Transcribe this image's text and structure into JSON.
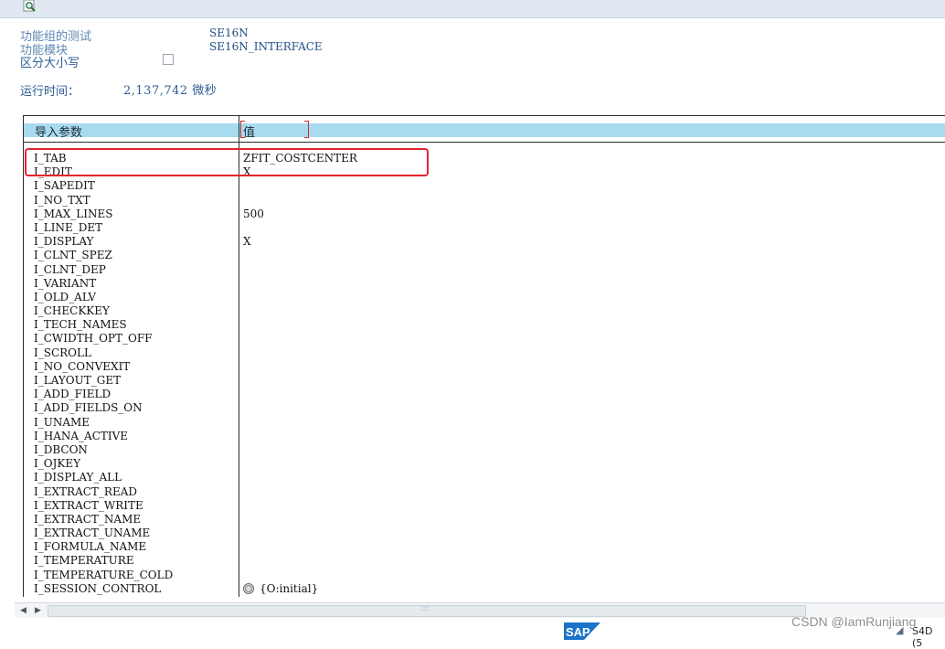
{
  "toolbar": {
    "icon": "execute-magnifier-icon"
  },
  "header": {
    "test_label": "功能组的测试",
    "test_value": "SE16N",
    "module_label": "功能模块",
    "module_value": "SE16N_INTERFACE",
    "case_label": "区分大小写",
    "case_checked": false,
    "runtime_label": "运行时间：",
    "runtime_value": "2,137,742 微秒"
  },
  "table": {
    "col_param": "导入参数",
    "col_value": "值",
    "params": [
      "I_TAB",
      "I_EDIT",
      "I_SAPEDIT",
      "I_NO_TXT",
      "I_MAX_LINES",
      "I_LINE_DET",
      "I_DISPLAY",
      "I_CLNT_SPEZ",
      "I_CLNT_DEP",
      "I_VARIANT",
      "I_OLD_ALV",
      "I_CHECKKEY",
      "I_TECH_NAMES",
      "I_CWIDTH_OPT_OFF",
      "I_SCROLL",
      "I_NO_CONVEXIT",
      "I_LAYOUT_GET",
      "I_ADD_FIELD",
      "I_ADD_FIELDS_ON",
      "I_UNAME",
      "I_HANA_ACTIVE",
      "I_DBCON",
      "I_OJKEY",
      "I_DISPLAY_ALL",
      "I_EXTRACT_READ",
      "I_EXTRACT_WRITE",
      "I_EXTRACT_NAME",
      "I_EXTRACT_UNAME",
      "I_FORMULA_NAME",
      "I_TEMPERATURE",
      "I_TEMPERATURE_COLD",
      "I_SESSION_CONTROL"
    ],
    "values": [
      "ZFIT_COSTCENTER",
      "X",
      "",
      "",
      "500",
      "",
      "X",
      "",
      "",
      "",
      "",
      "",
      "",
      "",
      "",
      "",
      "",
      "",
      "",
      "",
      "",
      "",
      "",
      "",
      "",
      "",
      "",
      "",
      "",
      "",
      "",
      ""
    ],
    "session_value": "{O:initial}"
  },
  "footer": {
    "sap_logo": "SAP",
    "system": "S4D (5",
    "watermark": "CSDN @IamRunjiang"
  },
  "colors": {
    "header_band": "#a9dbf0",
    "label_blue": "#5f87b3",
    "highlight_red": "#e0262f"
  }
}
